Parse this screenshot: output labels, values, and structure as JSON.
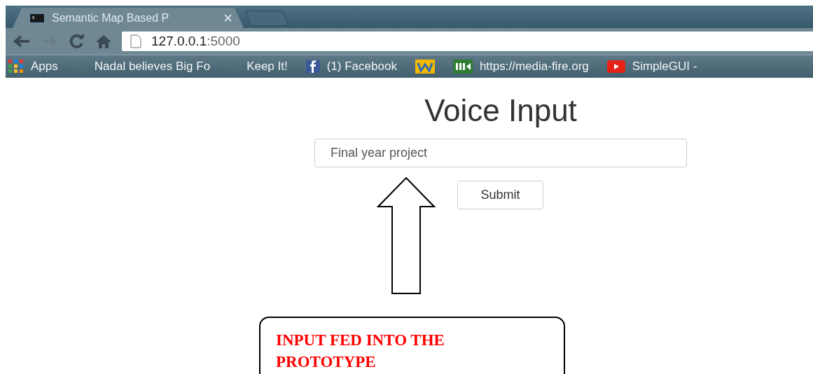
{
  "browser": {
    "tabs": [
      {
        "title": "Semantic Map Based P",
        "selected": true,
        "close": "×"
      },
      {
        "kind": "new",
        "selected": false
      }
    ],
    "address": {
      "host": "127.0.0.1",
      "port": ":5000"
    },
    "bookmarks": [
      {
        "kind": "apps",
        "label": "Apps"
      },
      {
        "kind": "page",
        "label": "Nadal believes Big Fo"
      },
      {
        "kind": "page",
        "label": "Keep It!"
      },
      {
        "kind": "facebook",
        "label": "(1) Facebook"
      },
      {
        "kind": "w"
      },
      {
        "kind": "media",
        "label": "https://media-fire.org"
      },
      {
        "kind": "youtube",
        "label": "SimpleGUI -"
      }
    ]
  },
  "page": {
    "heading": "Voice Input",
    "input": {
      "value": "Final year project"
    },
    "button": "Submit"
  },
  "annotation": {
    "callout": "INPUT FED INTO THE PROTOTYPE"
  }
}
